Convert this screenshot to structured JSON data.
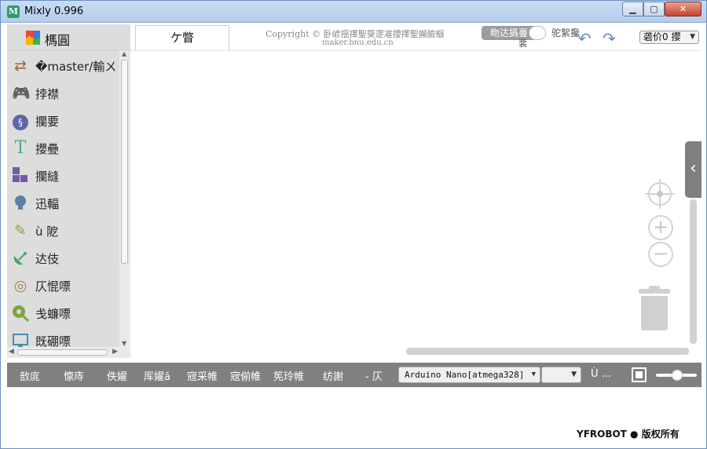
{
  "window": {
    "title": "Mixly 0.996",
    "icon_letter": "M",
    "controls": {
      "minimize": "▁",
      "maximize": "▢",
      "close": "✕"
    }
  },
  "toolbox": {
    "title": "榪圓",
    "categories": [
      {
        "label": "�master/輸ㄨ",
        "icon": "arrows-icon",
        "color": "#a0633b"
      },
      {
        "label": "挬襟",
        "icon": "gamepad-icon",
        "color": "#5ba55b"
      },
      {
        "label": "攔要",
        "icon": "loop-icon",
        "color": "#5b67a5"
      },
      {
        "label": "攖疉",
        "icon": "text-icon",
        "color": "#5ba58c"
      },
      {
        "label": "攔縫",
        "icon": "blocks-icon",
        "color": "#745ba5"
      },
      {
        "label": "迅輻",
        "icon": "bulb-icon",
        "color": "#5b80a5"
      },
      {
        "label": "ù 阸",
        "icon": "pen-icon",
        "color": "#8aa53c"
      },
      {
        "label": "达伎",
        "icon": "satellite-icon",
        "color": "#4aa56a"
      },
      {
        "label": "仄惃嘌",
        "icon": "sound-icon",
        "color": "#a5834b"
      },
      {
        "label": "戋蠊嘌",
        "icon": "pin-icon",
        "color": "#7ea53c"
      },
      {
        "label": "既硼嘌",
        "icon": "monitor-icon",
        "color": "#4a8ca5"
      }
    ]
  },
  "topbar": {
    "tab_label": "ケ瞥",
    "copyright": "Copyright © 卧嵃揺擇聖葵遻凗攖擇聖攧臉櫾",
    "site": "maker.bnu.edu.cn",
    "switch_on": "昒达撝亹",
    "switch_knob_text": "裴",
    "switch_off": "驼絮攙",
    "language": "砻价0 攖"
  },
  "bottombar": {
    "buttons": [
      "敨庣",
      "懔庤",
      "佚嬥",
      "厍嬥ā",
      "宼采帷",
      "宼偂帷",
      "筅玲帷",
      "纺謝",
      "- 仄"
    ],
    "board": "Arduino Nano[atmega328]",
    "port": "",
    "more": "Ù ..."
  },
  "footer": {
    "brand": "YFROBOT ● 版权所有"
  }
}
